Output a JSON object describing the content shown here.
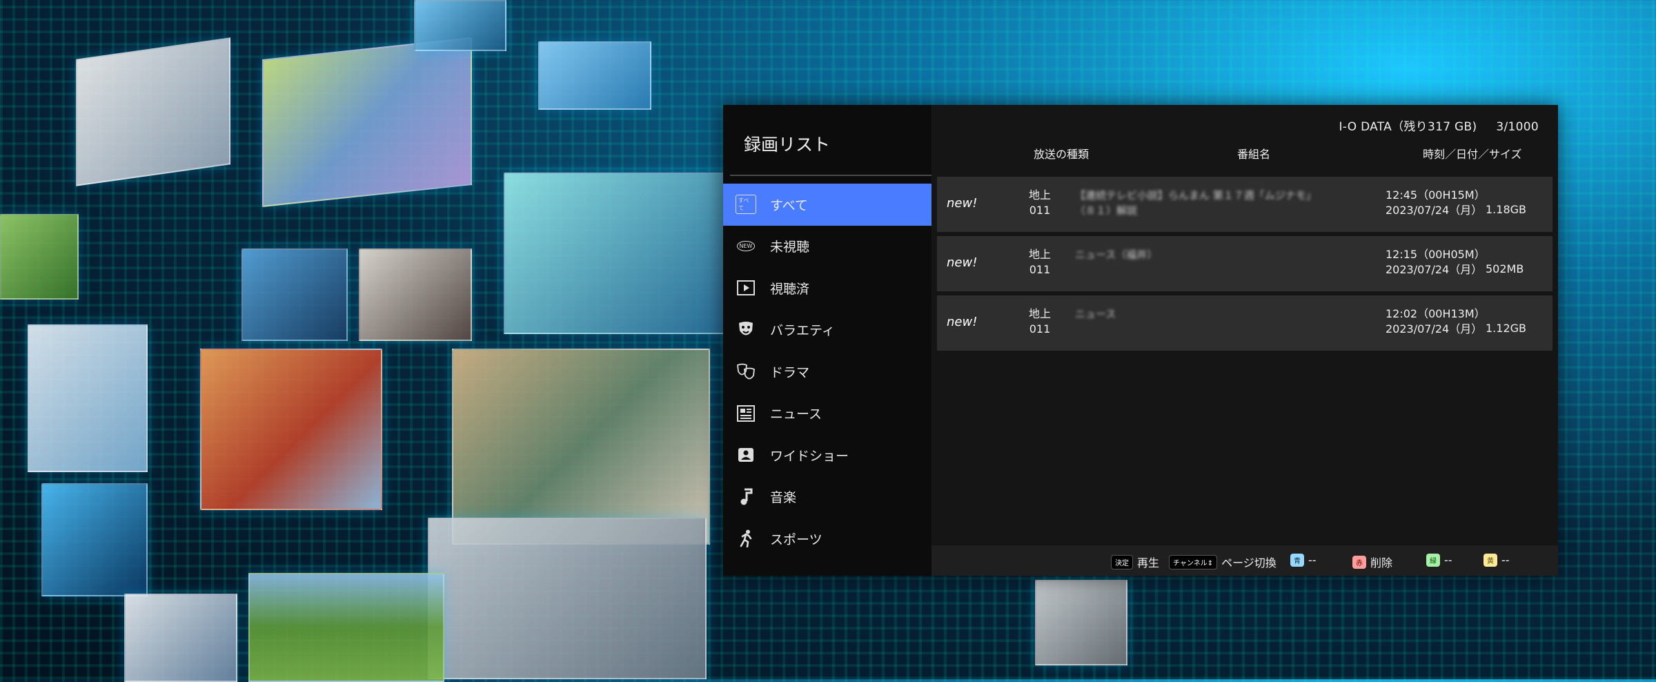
{
  "sidebar": {
    "title": "録画リスト",
    "items": [
      {
        "label": "すべて",
        "icon": "all-badge-icon",
        "badge": "すべて",
        "active": true
      },
      {
        "label": "未視聴",
        "icon": "new-badge-icon",
        "badge": "NEW"
      },
      {
        "label": "視聴済",
        "icon": "play-icon"
      },
      {
        "label": "バラエティ",
        "icon": "mask-icon"
      },
      {
        "label": "ドラマ",
        "icon": "theater-masks-icon"
      },
      {
        "label": "ニュース",
        "icon": "newspaper-icon"
      },
      {
        "label": "ワイドショー",
        "icon": "person-card-icon"
      },
      {
        "label": "音楽",
        "icon": "music-note-icon"
      },
      {
        "label": "スポーツ",
        "icon": "runner-icon"
      }
    ]
  },
  "storage": {
    "device": "I-O DATA（残り317 GB)",
    "count": "3/1000"
  },
  "headers": {
    "broadcast": "放送の種類",
    "program": "番組名",
    "datetime": "時刻／日付／サイズ"
  },
  "recordings": [
    {
      "badge": "new!",
      "broadcast": "地上",
      "channel": "011",
      "title_line1": "【連続テレビ小説】らんまん 第１７週「ムジナモ」",
      "title_line2": "（８１）解説",
      "time": "12:45（00H15M）",
      "date": "2023/07/24（月）",
      "size": "1.18GB"
    },
    {
      "badge": "new!",
      "broadcast": "地上",
      "channel": "011",
      "title_line1": "ニュース（福井）",
      "title_line2": "",
      "time": "12:15（00H05M）",
      "date": "2023/07/24（月）",
      "size": "502MB"
    },
    {
      "badge": "new!",
      "broadcast": "地上",
      "channel": "011",
      "title_line1": "ニュース",
      "title_line2": "",
      "time": "12:02（00H13M）",
      "date": "2023/07/24（月）",
      "size": "1.12GB"
    }
  ],
  "footer": {
    "enter_key": "決定",
    "play": "再生",
    "channel_key": "チャンネル⇕",
    "page": "ページ切換",
    "blue_key": "青",
    "blue_action": "--",
    "red_key": "赤",
    "red_action": "削除",
    "green_key": "緑",
    "green_action": "--",
    "yellow_key": "黄",
    "yellow_action": "--"
  },
  "colors": {
    "accent": "#4a7cff",
    "panel": "#111111",
    "row": "#2e2e2e"
  }
}
